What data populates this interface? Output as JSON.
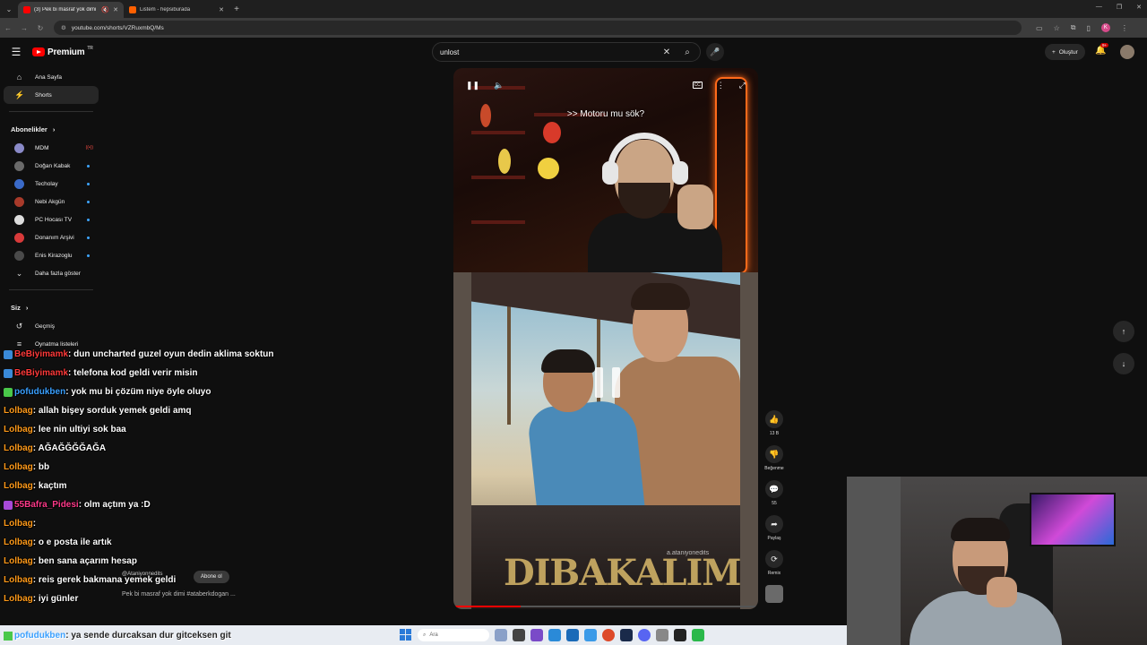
{
  "browser": {
    "tabs": [
      {
        "title": "(3) Pek bi masraf yok dimi ...",
        "fav_color": "#ff0000",
        "active": true
      },
      {
        "title": "Listem - hepsiburada",
        "fav_color": "#ff6000",
        "active": false
      }
    ],
    "url": "youtube.com/shorts/VZRuxmbQ/Ms"
  },
  "header": {
    "logo_text": "Premium",
    "region": "TR",
    "search_value": "unlost",
    "create_label": "Oluştur",
    "notif_count": "9+"
  },
  "sidebar": {
    "top": [
      {
        "label": "Ana Sayfa",
        "icon": "home-icon"
      },
      {
        "label": "Shorts",
        "icon": "shorts-icon"
      }
    ],
    "subs_title": "Abonelikler",
    "channels": [
      {
        "label": "MDM",
        "color": "#8a8ac8",
        "live": true
      },
      {
        "label": "Doğan Kabak",
        "color": "#6a6a6a"
      },
      {
        "label": "Techolay",
        "color": "#3a6ac8"
      },
      {
        "label": "Nebi Akgün",
        "color": "#a83a2a"
      },
      {
        "label": "PC Hocası TV",
        "color": "#ddd"
      },
      {
        "label": "Donanım Arşivi",
        "color": "#d83a3a"
      },
      {
        "label": "Enis Kirazoglu",
        "color": "#4a4a4a"
      }
    ],
    "more_label": "Daha fazla göster",
    "you_title": "Siz",
    "you_items": [
      {
        "label": "Geçmiş",
        "icon": "history-icon"
      },
      {
        "label": "Oynatma listeleri",
        "icon": "playlist-icon"
      }
    ]
  },
  "player": {
    "subtitle": ">> Motoru mu sök?",
    "watermark": "DIBAKALIM",
    "credit": "a.ataniyonedits",
    "progress": 0.22
  },
  "actions": [
    {
      "label": "13 B",
      "icon": "like-icon",
      "glyph": "👍"
    },
    {
      "label": "Beğenme",
      "icon": "dislike-icon",
      "glyph": "👎"
    },
    {
      "label": "55",
      "icon": "comment-icon",
      "glyph": "💬"
    },
    {
      "label": "Paylaş",
      "icon": "share-icon",
      "glyph": "➦"
    },
    {
      "label": "Remix",
      "icon": "remix-icon",
      "glyph": "⟳"
    }
  ],
  "channel": {
    "handle": "@Ataniyonnedits",
    "subscribe": "Abone ol",
    "description": "Pek bi masraf yok dimi #ataberkdogan ..."
  },
  "chat": [
    {
      "user": "BeBiyimamk",
      "color": "#ff3a3a",
      "text": ": dun uncharted guzel oyun dedin aklima soktun",
      "badge": "#3a8ad8"
    },
    {
      "user": "BeBiyimamk",
      "color": "#ff3a3a",
      "text": ": telefona kod geldi verir misin",
      "badge": "#3a8ad8"
    },
    {
      "user": "pofudukben",
      "color": "#3aa0ff",
      "text": ": yok mu bi çözüm niye öyle oluyo",
      "badge": "#4ac84a"
    },
    {
      "user": "Lolbag",
      "color": "#ff9a1a",
      "text": ": allah bişey sorduk yemek geldi amq"
    },
    {
      "user": "Lolbag",
      "color": "#ff9a1a",
      "text": ": lee nin ultiyi sok baa"
    },
    {
      "user": "Lolbag",
      "color": "#ff9a1a",
      "text": ": AĞAĞĞĞĞAĞA"
    },
    {
      "user": "Lolbag",
      "color": "#ff9a1a",
      "text": ": bb"
    },
    {
      "user": "Lolbag",
      "color": "#ff9a1a",
      "text": ": kaçtım"
    },
    {
      "user": "55Bafra_Pidesi",
      "color": "#ff3a8a",
      "text": ": olm açtım ya :D",
      "badge": "#a84ad8"
    },
    {
      "user": "Lolbag",
      "color": "#ff9a1a",
      "text": ":"
    },
    {
      "user": "Lolbag",
      "color": "#ff9a1a",
      "text": ": o e posta ile artık"
    },
    {
      "user": "Lolbag",
      "color": "#ff9a1a",
      "text": ": ben sana açarım hesap"
    },
    {
      "user": "Lolbag",
      "color": "#ff9a1a",
      "text": ": reis gerek bakmana yemek geldi"
    },
    {
      "user": "Lolbag",
      "color": "#ff9a1a",
      "text": ": iyi günler"
    }
  ],
  "chat_last": {
    "user": "pofudukben",
    "color": "#3aa0ff",
    "text": ": ya sende durcaksan dur gitceksen git"
  },
  "taskbar": {
    "search_placeholder": "Ara"
  }
}
